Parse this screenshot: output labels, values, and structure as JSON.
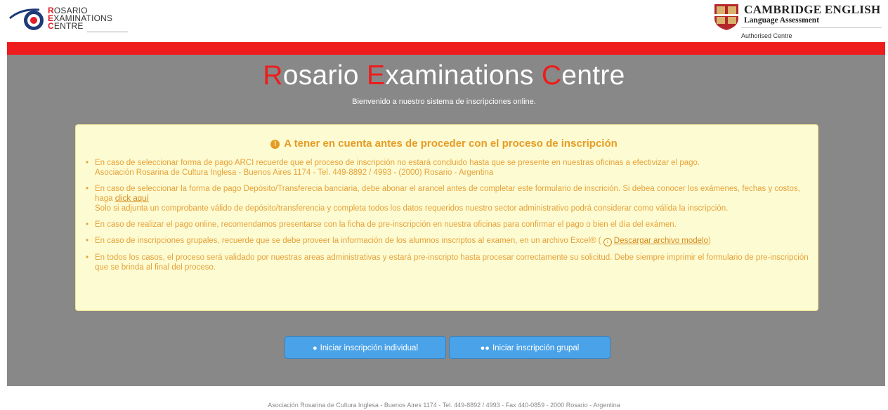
{
  "header": {
    "rec_logo": {
      "line1_initial": "R",
      "line1_rest": "OSARIO",
      "line2_initial": "E",
      "line2_rest": "XAMINATIONS",
      "line3_initial": "C",
      "line3_rest": "ENTRE"
    },
    "cambridge": {
      "title": "CAMBRIDGE ENGLISH",
      "subtitle": "Language Assessment",
      "authorised": "Authorised Centre"
    }
  },
  "hero": {
    "title_parts": [
      "R",
      "osario ",
      "E",
      "xaminations ",
      "C",
      "entre"
    ],
    "subtitle": "Bienvenido a nuestro sistema de inscripciones online."
  },
  "notice": {
    "title": "A tener en cuenta antes de proceder con el proceso de inscripción",
    "items": [
      {
        "text": "En caso de seleccionar forma de pago ARCI recuerde que el proceso de inscripción no estará concluido hasta que se presente en nuestras oficinas a efectivizar el pago.",
        "line2": "Asociación Rosarina de Cultura Inglesa - Buenos Aires 1174 - Tel. 449-8892 / 4993 - (2000) Rosario - Argentina"
      },
      {
        "text": "En caso de seleccionar la forma de pago Depósito/Transferecia banciaria, debe abonar el arancel antes de completar este formulario de inscrición. Si debea conocer los exámenes, fechas y costos, haga",
        "link": "click aquí",
        "line2": "Solo si adjunta un comprobante válido de depósito/transferencia y completa todos los datos requeridos nuestro sector administrativo podrá considerar como válida la inscripción."
      },
      {
        "text": "En caso de realizar el pago online, recomendamos presentarse con la ficha de pre-inscripción en nuestra oficinas para confirmar el pago o bien el día del exámen."
      },
      {
        "text": "En caso de inscripciones grupales, recuerde que se debe proveer la información de los alumnos inscriptos al examen, en un archivo Excel® (",
        "link": "Descargar archivo modelo",
        "after": ")"
      },
      {
        "text": "En todos los casos, el proceso será validado por nuestras areas administrativas y estará pre-inscripto hasta procesar correctamente su solicitud. Debe siempre imprimir el formulario de pre-inscripción que se brinda al final del proceso."
      }
    ]
  },
  "buttons": {
    "individual": "Iniciar inscripción individual",
    "grupal": "Iniciar inscripción grupal"
  },
  "footer": "Asociación Rosarina de Cultura Inglesa - Buenos Aires 1174 - Tel. 449-8892 / 4993 - Fax 440-0859 - 2000 Rosario - Argentina",
  "colors": {
    "accent_red": "#ee1c1c",
    "hero_gray": "#888888",
    "notice_bg": "#fdfbd2",
    "notice_text": "#e6a23a",
    "button_blue": "#4aa2e8"
  }
}
